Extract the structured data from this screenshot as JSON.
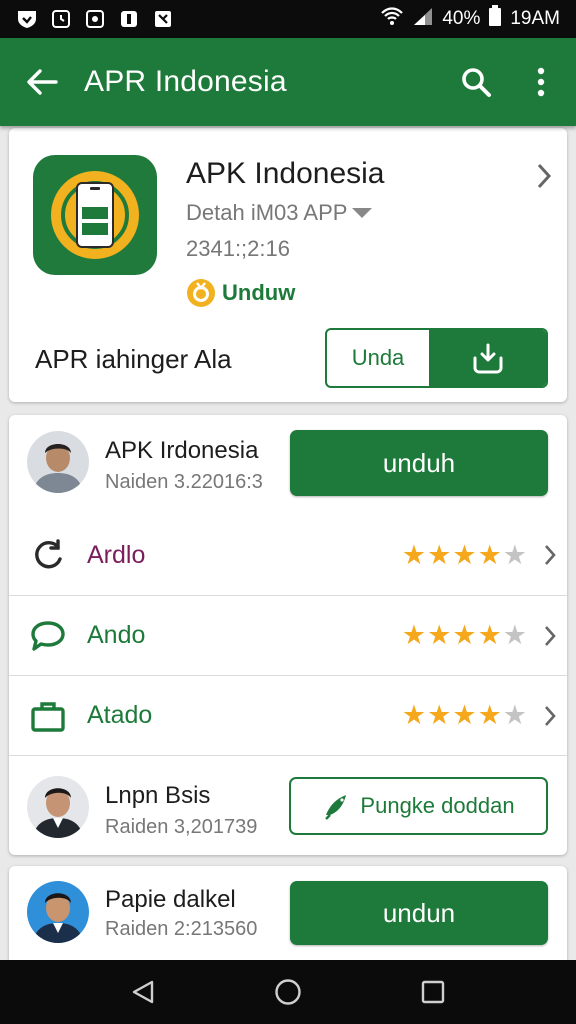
{
  "status": {
    "battery": "40%",
    "time": "19AM"
  },
  "appbar": {
    "title": "APR Indonesia"
  },
  "app": {
    "name": "APK Indonesia",
    "developer": "Detah iM03 APP",
    "version": "2341:;2:16",
    "badge": "Unduw",
    "footer_text": "APR iahinger Ala",
    "left_button": "Unda"
  },
  "people": [
    {
      "name": "APK Irdonesia",
      "meta": "Naiden 3.22016:3",
      "button": "unduh"
    },
    {
      "name": "Lnpn Bsis",
      "meta": "Raiden 3,201739",
      "button": "Pungke doddan"
    },
    {
      "name": "Papie dalkel",
      "meta": "Raiden 2:213560",
      "button": "undun"
    }
  ],
  "categories": [
    {
      "label": "Ardlo",
      "color": "#7a1f5c",
      "rating": 4,
      "max": 5,
      "icon": "refresh-icon"
    },
    {
      "label": "Ando",
      "color": "#1e7a3a",
      "rating": 4,
      "max": 5,
      "icon": "chat-icon"
    },
    {
      "label": "Atado",
      "color": "#1e7a3a",
      "rating": 4,
      "max": 5,
      "icon": "briefcase-icon"
    }
  ],
  "colors": {
    "primary": "#1e7a3a",
    "star": "#f5a81c",
    "star_off": "#c4c4c4"
  }
}
